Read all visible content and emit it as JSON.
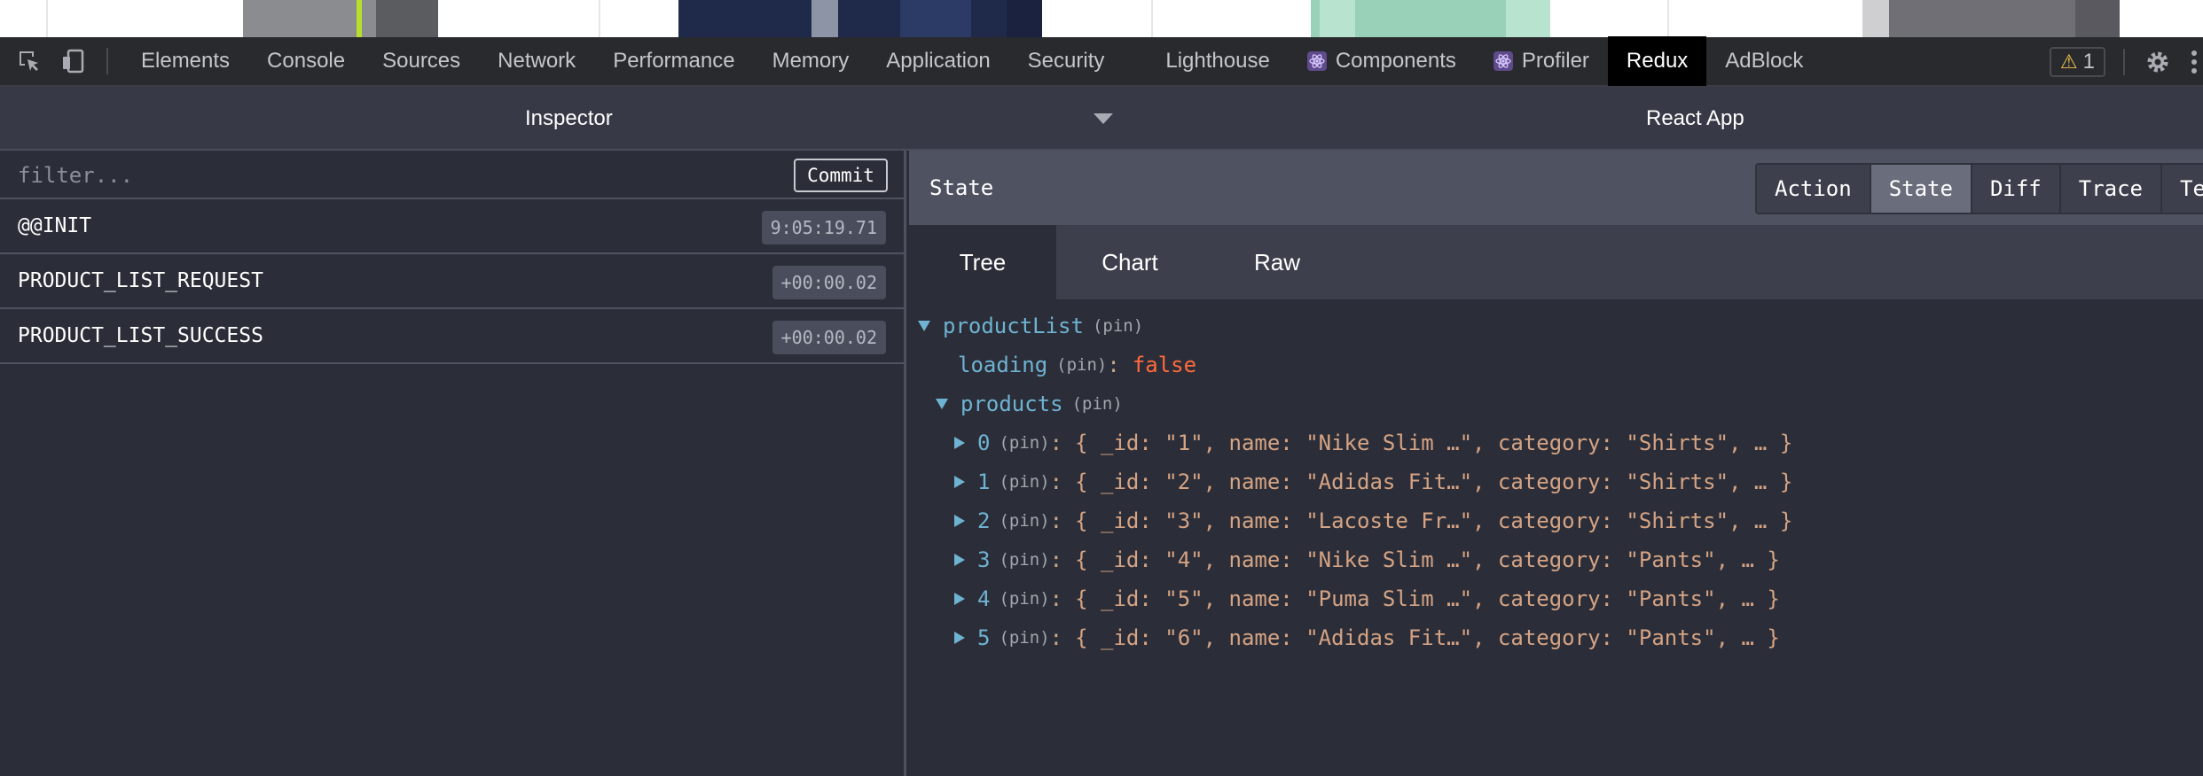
{
  "devtools": {
    "tabs": [
      {
        "label": "Elements"
      },
      {
        "label": "Console"
      },
      {
        "label": "Sources"
      },
      {
        "label": "Network"
      },
      {
        "label": "Performance"
      },
      {
        "label": "Memory"
      },
      {
        "label": "Application"
      },
      {
        "label": "Security"
      },
      {
        "label": "Lighthouse"
      },
      {
        "label": "Components"
      },
      {
        "label": "Profiler"
      },
      {
        "label": "Redux"
      },
      {
        "label": "AdBlock"
      }
    ],
    "active_tab": "Redux",
    "warning_count": "1"
  },
  "redux": {
    "inspector_label": "Inspector",
    "instance_label": "React App",
    "filter_placeholder": "filter...",
    "commit_label": "Commit",
    "actions": [
      {
        "name": "@@INIT",
        "time": "9:05:19.71"
      },
      {
        "name": "PRODUCT_LIST_REQUEST",
        "time": "+00:00.02"
      },
      {
        "name": "PRODUCT_LIST_SUCCESS",
        "time": "+00:00.02"
      }
    ],
    "panel_title": "State",
    "monitor_tabs": [
      "Action",
      "State",
      "Diff",
      "Trace",
      "Test"
    ],
    "active_monitor_tab": "State",
    "view_tabs": [
      "Tree",
      "Chart",
      "Raw"
    ],
    "active_view_tab": "Tree",
    "tree": {
      "root_key": "productList",
      "pin_label": "(pin)",
      "loading_key": "loading",
      "loading_value": "false",
      "products_key": "products",
      "items": [
        {
          "index": "0",
          "value": "{ _id: \"1\", name: \"Nike Slim …\", category: \"Shirts\", … }"
        },
        {
          "index": "1",
          "value": "{ _id: \"2\", name: \"Adidas Fit…\", category: \"Shirts\", … }"
        },
        {
          "index": "2",
          "value": "{ _id: \"3\", name: \"Lacoste Fr…\", category: \"Shirts\", … }"
        },
        {
          "index": "3",
          "value": "{ _id: \"4\", name: \"Nike Slim …\", category: \"Pants\", … }"
        },
        {
          "index": "4",
          "value": "{ _id: \"5\", name: \"Puma Slim …\", category: \"Pants\", … }"
        },
        {
          "index": "5",
          "value": "{ _id: \"6\", name: \"Adidas Fit…\", category: \"Pants\", … }"
        }
      ]
    }
  },
  "colors": {
    "active_tab_bg": "#000000",
    "tree_key": "#6fb3d2",
    "tree_bool": "#ff6a3d",
    "tree_value": "#d5a384"
  }
}
